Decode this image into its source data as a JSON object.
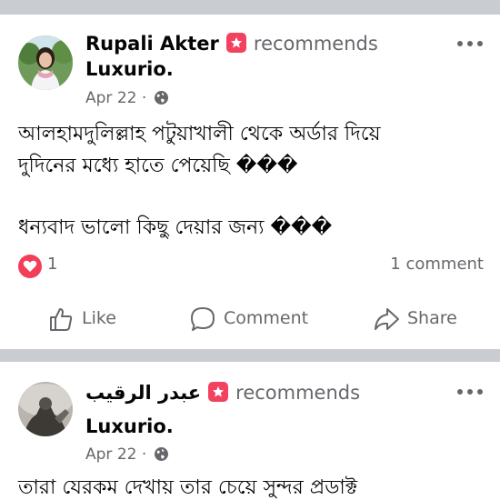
{
  "posts": [
    {
      "author": "Rupali Akter",
      "recommends_label": "recommends",
      "page": "Luxurio.",
      "date": "Apr 22 ·",
      "lines": [
        "আলহামদুলিল্লাহ পটুয়াখালী থেকে অর্ডার দিয়ে",
        "দুদিনের মধ্যে হাতে পেয়েছি ���",
        "ধন্যবাদ ভালো কিছু দেয়ার জন্য ���"
      ],
      "reaction_count": "1",
      "comment_count": "1 comment",
      "actions": {
        "like": "Like",
        "comment": "Comment",
        "share": "Share"
      }
    },
    {
      "author": "عبدر الرقيب",
      "recommends_label": "recommends",
      "page": "Luxurio.",
      "date": "Apr 22 ·",
      "lines": [
        "তারা যেরকম দেখায় তার চেয়ে সুন্দর প্রডাক্ট"
      ]
    }
  ],
  "icons": {
    "badge": "recommend-star-icon",
    "globe": "globe-icon",
    "more": "more-dots-icon",
    "reaction": "love-reaction-icon",
    "like": "thumbs-up-icon",
    "comment": "comment-bubble-icon",
    "share": "share-arrow-icon"
  },
  "colors": {
    "badge": "#f3425f",
    "reaction": "#f33e58",
    "secondary_text": "#65676b",
    "separator": "#c9ccd1"
  }
}
